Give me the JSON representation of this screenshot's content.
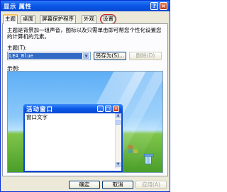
{
  "window": {
    "title": "显示 属性",
    "help_glyph": "?",
    "close_glyph": "×"
  },
  "tabs": [
    {
      "label": "主题"
    },
    {
      "label": "桌面"
    },
    {
      "label": "屏幕保护程序"
    },
    {
      "label": "外观"
    },
    {
      "label": "设置"
    }
  ],
  "theme_panel": {
    "description": "主题是背景加一组声音，图标以及只需单击即可帮您个性化设置您的计算机的元素。",
    "theme_label": "主题(T):",
    "theme_value": "LE4_Blue",
    "save_as_label": "另存为(S)...",
    "delete_label": "删除(D)",
    "preview_label": "示例:"
  },
  "preview": {
    "active_window_title": "活动窗口",
    "window_text": "窗口文字",
    "min_glyph": "_",
    "max_glyph": "□",
    "close_glyph": "×",
    "scroll_up_glyph": "▲",
    "scroll_down_glyph": "▼"
  },
  "buttons": {
    "ok": "确定",
    "cancel": "取消",
    "apply": "应用(A)"
  },
  "colors": {
    "titlebar": "#0a58e8",
    "dialog_bg": "#ece9d8",
    "selection": "#316ac5",
    "active_tab_highlight": "#f5c060"
  }
}
